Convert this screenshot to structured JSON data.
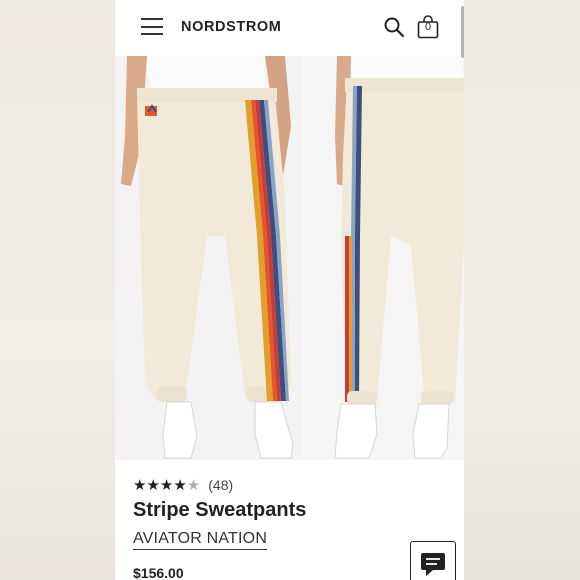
{
  "header": {
    "logo": "NORDSTROM",
    "bag_count": "0",
    "menu_icon": "hamburger-menu-icon",
    "search_icon": "search-icon",
    "bag_icon": "shopping-bag-icon"
  },
  "gallery": {
    "images": [
      {
        "name": "front-view"
      },
      {
        "name": "side-view"
      }
    ],
    "stripe_colors": [
      "#e0a02a",
      "#e8542b",
      "#c93b3a",
      "#3e4f7d",
      "#8aa4c8"
    ],
    "pant_color": "#f1ead8"
  },
  "product": {
    "rating_value": 4.5,
    "rating_stars_filled": 4,
    "review_count": "(48)",
    "title": "Stripe Sweatpants",
    "brand": "AVIATOR NATION",
    "price": "$156.00"
  },
  "chat": {
    "icon": "chat-icon"
  },
  "colors": {
    "text": "#222222",
    "background": "#ffffff"
  }
}
